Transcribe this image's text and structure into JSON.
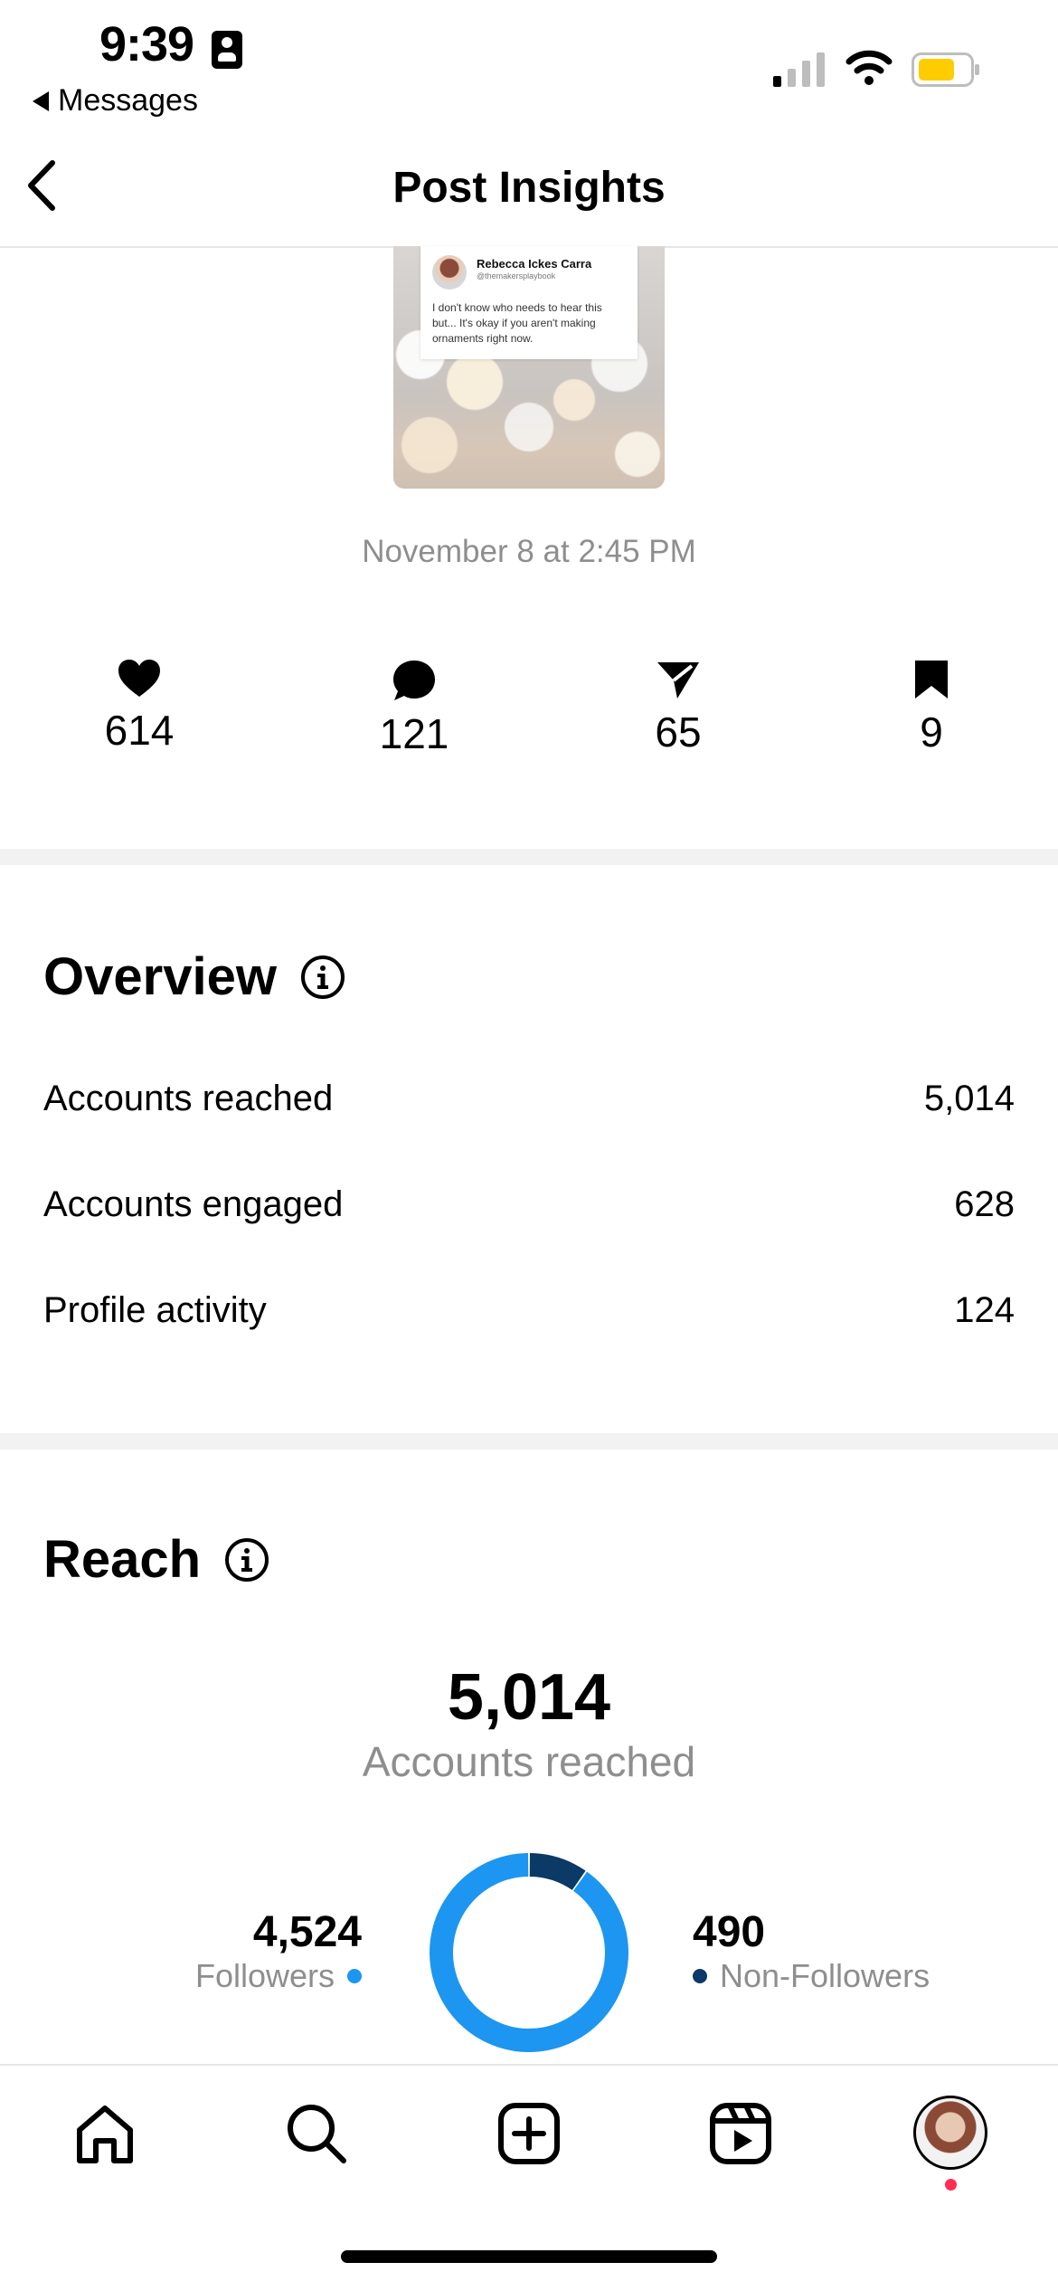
{
  "status_bar": {
    "time": "9:39",
    "back_app": "Messages",
    "battery_color": "#ffcc00"
  },
  "header": {
    "title": "Post Insights",
    "back_icon": "chevron-left-icon"
  },
  "post": {
    "tweet_name": "Rebecca Ickes Carra",
    "tweet_handle": "@themakersplaybook",
    "tweet_text": "I don't know who needs to hear this but... It's okay if you aren't making ornaments right now.",
    "date": "November 8 at 2:45 PM"
  },
  "engagement": {
    "likes": "614",
    "comments": "121",
    "shares": "65",
    "saves": "9"
  },
  "overview": {
    "title": "Overview",
    "rows": [
      {
        "label": "Accounts reached",
        "value": "5,014"
      },
      {
        "label": "Accounts engaged",
        "value": "628"
      },
      {
        "label": "Profile activity",
        "value": "124"
      }
    ]
  },
  "reach": {
    "title": "Reach",
    "total": "5,014",
    "total_label": "Accounts reached",
    "followers_value": "4,524",
    "followers_label": "Followers",
    "non_followers_value": "490",
    "non_followers_label": "Non-Followers",
    "followers_color": "#1c96f0",
    "non_followers_color": "#0b3a66"
  },
  "chart_data": {
    "type": "pie",
    "donut": true,
    "categories": [
      "Followers",
      "Non-Followers"
    ],
    "values": [
      4524,
      490
    ],
    "colors": [
      "#1c96f0",
      "#0b3a66"
    ]
  },
  "tab_bar": {
    "items": [
      "home-icon",
      "search-icon",
      "create-icon",
      "reels-icon",
      "profile-avatar"
    ]
  }
}
